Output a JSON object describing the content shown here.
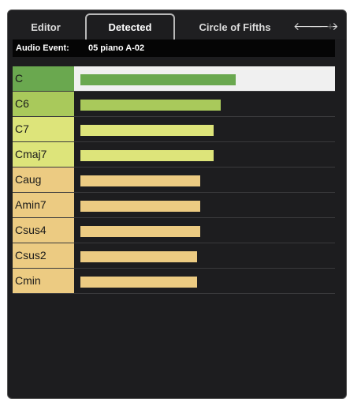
{
  "tabs": {
    "editor": "Editor",
    "detected": "Detected",
    "circle": "Circle of Fifths"
  },
  "nav": {
    "back_icon": "arrow-left-icon",
    "forward_icon": "arrow-right-icon",
    "add_icon": "plus-icon",
    "back_glyph": "🡐",
    "forward_glyph": "🡒",
    "add_glyph": "+"
  },
  "header": {
    "label": "Audio Event:",
    "value": "05 piano A-02"
  },
  "chords": [
    {
      "name": "C",
      "score": 0.92,
      "color": "#6aa84f",
      "bar_color": "#6aa84f",
      "selected": true
    },
    {
      "name": "C6",
      "score": 0.83,
      "color": "#a9c95b",
      "bar_color": "#a9c95b",
      "selected": false
    },
    {
      "name": "C7",
      "score": 0.79,
      "color": "#dde47a",
      "bar_color": "#dde47a",
      "selected": false
    },
    {
      "name": "Cmaj7",
      "score": 0.79,
      "color": "#dde47a",
      "bar_color": "#dde47a",
      "selected": false
    },
    {
      "name": "Caug",
      "score": 0.71,
      "color": "#eccb82",
      "bar_color": "#eccb82",
      "selected": false
    },
    {
      "name": "Amin7",
      "score": 0.71,
      "color": "#eccb82",
      "bar_color": "#eccb82",
      "selected": false
    },
    {
      "name": "Csus4",
      "score": 0.71,
      "color": "#eccb82",
      "bar_color": "#eccb82",
      "selected": false
    },
    {
      "name": "Csus2",
      "score": 0.69,
      "color": "#eccb82",
      "bar_color": "#eccb82",
      "selected": false
    },
    {
      "name": "Cmin",
      "score": 0.69,
      "color": "#eccb82",
      "bar_color": "#eccb82",
      "selected": false
    }
  ]
}
